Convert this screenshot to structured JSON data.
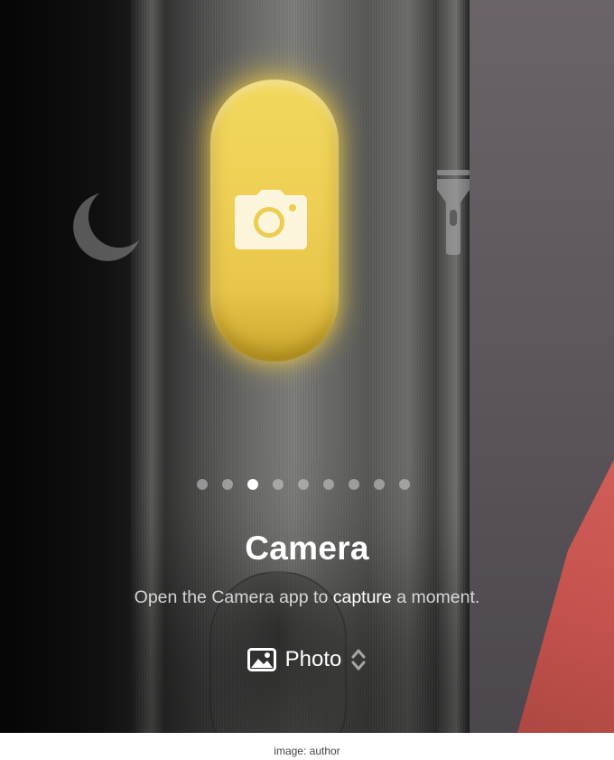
{
  "feature": {
    "title": "Camera",
    "subtitle_prefix": "Open the Camera app to ",
    "subtitle_emphasis": "capture",
    "subtitle_suffix": " a moment."
  },
  "pager": {
    "total": 9,
    "active_index": 2
  },
  "mode_selector": {
    "icon": "photo-icon",
    "label": "Photo",
    "chevron": "up-down-chevron-icon"
  },
  "icons": {
    "center": "camera-icon",
    "left": "moon-icon",
    "right": "flashlight-icon"
  },
  "colors": {
    "button_yellow": "#efd055",
    "button_glow": "#ffdc46",
    "accent_red": "#d9645e"
  },
  "caption": "image: author"
}
